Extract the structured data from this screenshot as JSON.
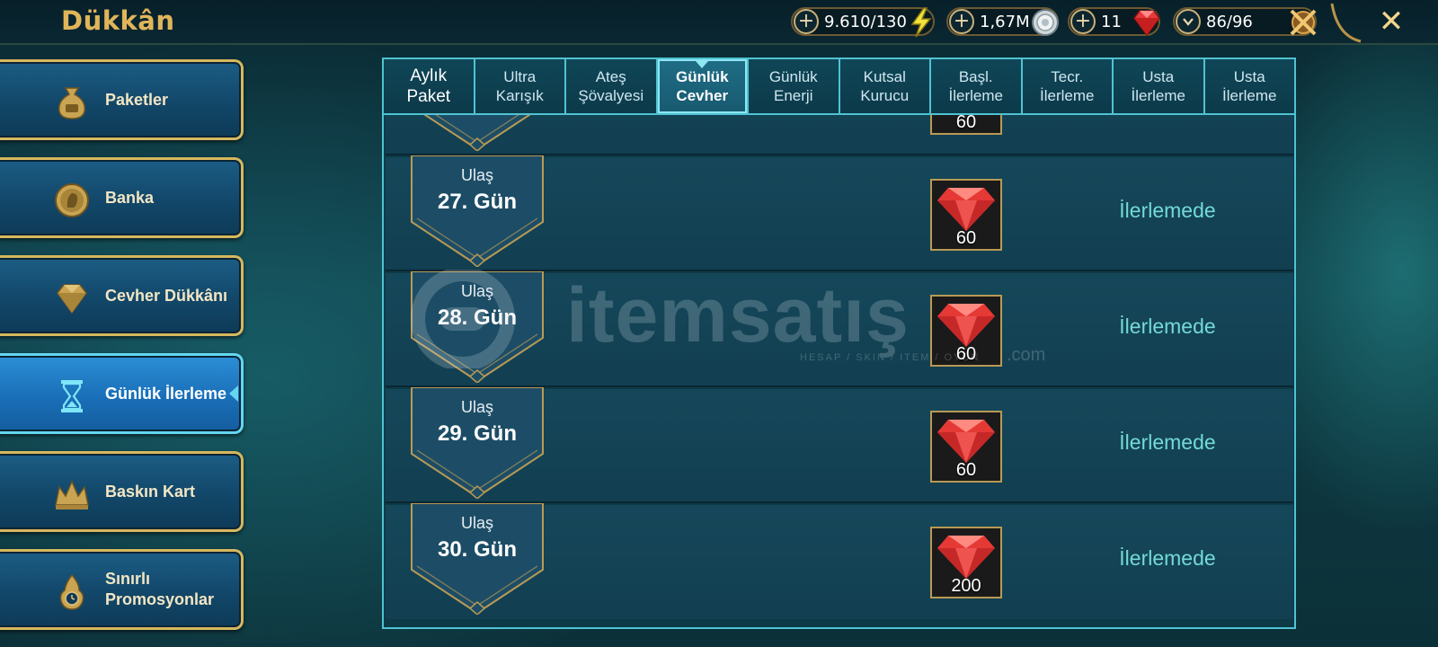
{
  "header": {
    "title": "Dükkân",
    "resources": [
      {
        "name": "energy",
        "value": "9.610/130",
        "icon": "lightning-icon",
        "color": "#f2e23a"
      },
      {
        "name": "silver",
        "value": "1,67M",
        "icon": "silver-coin-icon",
        "color": "#cfd8dc"
      },
      {
        "name": "gems",
        "value": "11",
        "icon": "ruby-icon",
        "color": "#e23b3b"
      },
      {
        "name": "arena-tokens",
        "value": "86/96",
        "icon": "crossed-swords-icon",
        "color": "#d9a44a"
      }
    ],
    "close_label": "✕"
  },
  "sidebar": {
    "items": [
      {
        "label": "Paketler",
        "icon": "money-bag-icon",
        "active": false
      },
      {
        "label": "Banka",
        "icon": "coin-face-icon",
        "active": false
      },
      {
        "label": "Cevher Dükkânı",
        "icon": "gem-shop-icon",
        "active": false
      },
      {
        "label": "Günlük İlerleme",
        "icon": "hourglass-icon",
        "active": true
      },
      {
        "label": "Baskın Kart",
        "icon": "crown-icon",
        "active": false
      },
      {
        "label": "Sınırlı\nPromosyonlar",
        "icon": "flame-timer-icon",
        "active": false
      }
    ]
  },
  "tabs": [
    {
      "label": "Aylık\nPaket",
      "active": false
    },
    {
      "label": "Ultra\nKarışık",
      "active": false
    },
    {
      "label": "Ateş\nŞövalyesi",
      "active": false
    },
    {
      "label": "Günlük\nCevher",
      "active": true
    },
    {
      "label": "Günlük\nEnerji",
      "active": false
    },
    {
      "label": "Kutsal\nKurucu",
      "active": false
    },
    {
      "label": "Başl.\nİlerleme",
      "active": false
    },
    {
      "label": "Tecr.\nİlerleme",
      "active": false
    },
    {
      "label": "Usta\nİlerleme",
      "active": false
    },
    {
      "label": "Usta\nİlerleme",
      "active": false
    }
  ],
  "partial_row": {
    "reward_amount": "60"
  },
  "rows": [
    {
      "reach_label": "Ulaş",
      "day": "27. Gün",
      "reward_amount": "60",
      "status": "İlerlemede"
    },
    {
      "reach_label": "Ulaş",
      "day": "28. Gün",
      "reward_amount": "60",
      "status": "İlerlemede"
    },
    {
      "reach_label": "Ulaş",
      "day": "29. Gün",
      "reward_amount": "60",
      "status": "İlerlemede"
    },
    {
      "reach_label": "Ulaş",
      "day": "30. Gün",
      "reward_amount": "200",
      "status": "İlerlemede"
    }
  ],
  "watermark": {
    "text": "itemsatış",
    "subtitle": "HESAP / SKIN / ITEM / OYUN",
    "suffix": ".com"
  }
}
